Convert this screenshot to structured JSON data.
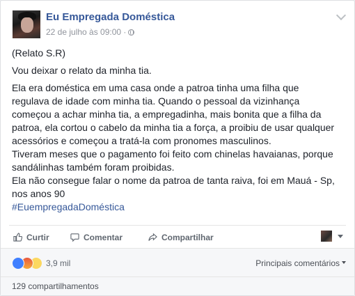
{
  "post": {
    "page_name": "Eu Empregada Doméstica",
    "timestamp": "22 de julho às 09:00 ·",
    "paragraphs": [
      "(Relato S.R)",
      "Vou deixar o relato da minha tia.",
      "Ela era doméstica em uma casa onde a patroa tinha uma filha que\nregulava de idade com minha tia. Quando o pessoal da vizinhança\ncomeçou a achar minha tia, a empregadinha, mais bonita que a filha da\npatroa, ela cortou o cabelo da minha tia a força, a proibiu de usar qualquer\nacessórios e começou a tratá-la com pronomes masculinos.\nTiveram meses que o pagamento foi feito com chinelas havaianas, porque\nsandálinhas também foram proibidas.\nEla não consegue falar o nome da patroa de tanta raiva, foi em Mauá - Sp,\nnos anos 90"
    ],
    "hashtag": "#EuempregadaDoméstica"
  },
  "actions": {
    "like_label": "Curtir",
    "comment_label": "Comentar",
    "share_label": "Compartilhar"
  },
  "reactions": {
    "count": "3,9 mil",
    "types": [
      "like-icon",
      "angry-icon",
      "sad-icon"
    ],
    "sort_label": "Principais comentários"
  },
  "shares": {
    "label": "129 compartilhamentos"
  },
  "colors": {
    "link": "#365899",
    "text": "#1d2129",
    "muted": "#90949c",
    "like_blue": "#4080ff"
  }
}
